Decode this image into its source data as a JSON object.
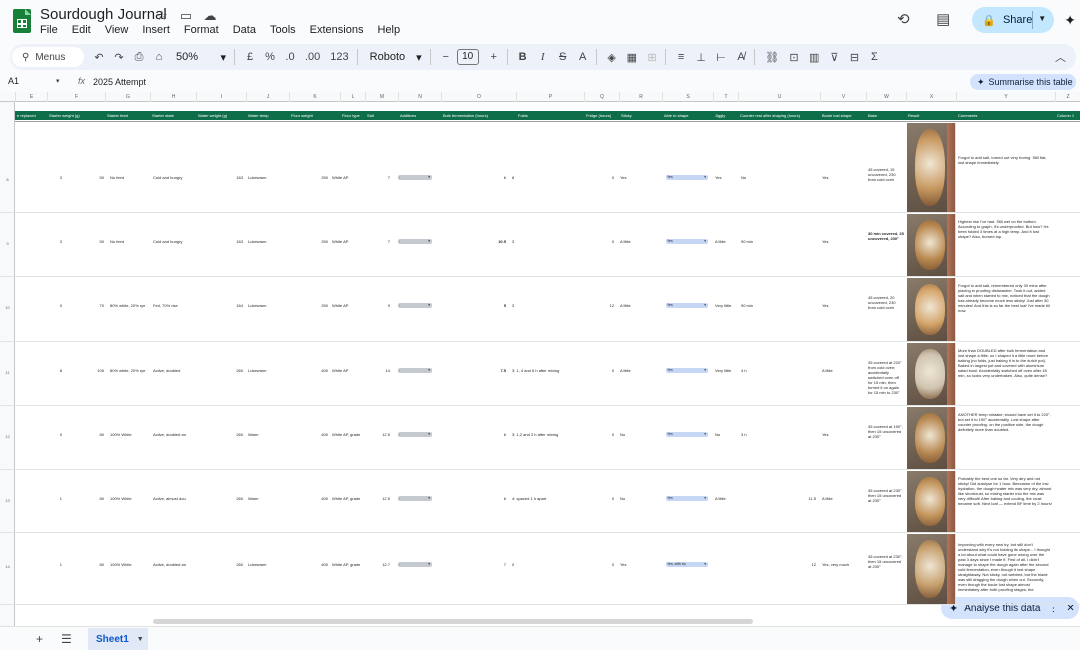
{
  "app": {
    "title": "Sourdough Journal",
    "menu": [
      "File",
      "Edit",
      "View",
      "Insert",
      "Format",
      "Data",
      "Tools",
      "Extensions",
      "Help"
    ],
    "share_label": "Share"
  },
  "toolbar": {
    "menus_label": "Menus",
    "zoom": "50%",
    "currency": "£",
    "percent": "%",
    "dec_dec": ".0",
    "dec_inc": ".00",
    "number_format": "123",
    "font": "Roboto",
    "font_size": "10"
  },
  "formula_bar": {
    "cell_ref": "A1",
    "fx": "fx",
    "content": "2025 Attempt",
    "summarise_label": "Summarise this table"
  },
  "grid": {
    "column_letters": [
      "E",
      "F",
      "G",
      "H",
      "I",
      "J",
      "K",
      "L",
      "M",
      "N",
      "O",
      "P",
      "Q",
      "R",
      "S",
      "T",
      "U",
      "V",
      "W",
      "X",
      "Y",
      "Z",
      "AA"
    ],
    "headers": [
      "e replaced",
      "Starter weight (g)",
      "Starter feed",
      "Starter state",
      "Water weight (g)",
      "Water temp",
      "Flour weight",
      "Flour type",
      "Salt",
      "Additives",
      "Bulk fermentation (hours)",
      "Folds",
      "Fridge (hours)",
      "Sticky",
      "Able to shape",
      "Jiggly",
      "Counter rest after shaping (hours)",
      "Boule lost shape",
      "Bake",
      "Result",
      "Comments",
      "Column 1"
    ],
    "rows": [
      {
        "n": "8",
        "e": "3",
        "f": "50",
        "g": "No feed",
        "h": "Cold and hungry",
        "i": "163",
        "j": "Lukewarm",
        "k": "250",
        "l": "White AP",
        "m": "7",
        "n2": "-",
        "o": "6",
        "o_bold": false,
        "p": "8",
        "q": "0",
        "r": "Yes",
        "s": "Yes",
        "t": "Yes",
        "u": "No",
        "v": "",
        "w": "Yes",
        "x": "45 covered, 15 uncovered, 230 from cold oven",
        "x_bold": false,
        "z": "Forgot to add salt, turned out very boring. Still flat, lost shape immediately."
      },
      {
        "n": "9",
        "e": "3",
        "f": "50",
        "g": "No feed",
        "h": "Cold and hungry",
        "i": "163",
        "j": "Lukewarm",
        "k": "250",
        "l": "White AP",
        "m": "7",
        "n2": "-",
        "o": "10.5",
        "o_bold": true,
        "p": "3",
        "q": "0",
        "r": "A little",
        "s": "Yes",
        "t": "A little",
        "u": "90 min",
        "v": "",
        "w": "Yes",
        "x": "30 min covered, 25 uncovered, 230°",
        "x_bold": true,
        "z": "Highest rise I've had. Still wet on the bottom. According to graph, it's underproofed. But how? It's been folded 3 times at a high temp. And it lost shape? Also, burned top."
      },
      {
        "n": "10",
        "e": "0",
        "f": "70",
        "g": "80% white, 20% rye",
        "h": "Fed, 70% rise",
        "i": "164",
        "j": "Lukewarm",
        "k": "250",
        "l": "White AP",
        "m": "9",
        "n2": "-",
        "o": "5",
        "o_bold": true,
        "p": "3",
        "q": "12",
        "r": "A little",
        "s": "Yes",
        "t": "Very little",
        "u": "90 min",
        "v": "",
        "w": "Yes",
        "x": "45 covered, 20 uncovered, 230 from cold oven",
        "x_bold": false,
        "z": "Forgot to add salt, remembered only 30 mins after placing in proofing dishwasher. Took it out, added salt and when started to mix, noticed that the dough has already become much less sticky! Just after 30 minutes! And this is so far the best loaf I've made till now."
      },
      {
        "n": "11",
        "e": "8",
        "f": "105",
        "g": "80% white, 20% rye",
        "h": "Active, doubled",
        "i": "260",
        "j": "Lukewarm",
        "k": "400",
        "l": "White AP",
        "m": "14",
        "n2": "-",
        "o": "7.5",
        "o_bold": true,
        "p": "3: 1, 4 and 6 h after mixing",
        "q": "0",
        "r": "A little",
        "s": "Yes",
        "t": "Very little",
        "u": "4 h",
        "v": "",
        "w": "A little",
        "x": "45 covered at 220° from cold oven; accidentally switched oven off for 15 min, then turned it on again for 15 min to 230°",
        "x_bold": false,
        "z": "More than DOUBLED after bulk fermentation and lost shape a little, so I shaped it a little more before baking (no folds, just baking it in to the dutch pot). Baked in largest pot and covered with aluminium salad bowl. Accidentally switched off oven after 45 min, so looks very underbaken. Also, quite dense?"
      },
      {
        "n": "12",
        "e": "0",
        "f": "80",
        "g": "100% White",
        "h": "Active, doubled an",
        "i": "260",
        "j": "Warm",
        "k": "400",
        "l": "White AP, grade",
        "m": "12.5",
        "n2": "-",
        "o": "6",
        "o_bold": false,
        "p": "3: 1,2 and 3 h after mixing",
        "q": "0",
        "r": "No",
        "s": "Yes",
        "t": "No",
        "u": "3 h",
        "v": "",
        "w": "Yes",
        "x": "45 covered at 190°, then 15 uncovered at 230°",
        "x_bold": false,
        "z": "ANOTHER temp mistake; should have set it to 220°, but set it to 190° accidentally. Lost shape after counter proofing. on the positive side, the dough definitely more than doubled."
      },
      {
        "n": "13",
        "e": "1",
        "f": "80",
        "g": "100% White",
        "h": "Active, almost dou",
        "i": "260",
        "j": "Warm",
        "k": "400",
        "l": "White AP, grade",
        "m": "12.5",
        "n2": "-",
        "o": "6",
        "o_bold": false,
        "p": "4: spaced 1 h apart",
        "q": "0",
        "r": "No",
        "s": "Yes",
        "t": "A little",
        "u": "",
        "v": "11.5",
        "w": "A little",
        "x": "45 covered at 230°, then 15 uncovered at 230°",
        "x_bold": false,
        "z": "Probably the best one so far. Very airy and not sticky! Did autolyse for 1 hour. Beecause of the low hydration, the dough+water mix was very dry, almost like shortcrust, so mixing starter into the mix was very difficult! After baking and cooling, the crust became soft. Next loaf — extend BF time by 2 hours!"
      },
      {
        "n": "14",
        "e": "1",
        "f": "80",
        "g": "100% White",
        "h": "Active, doubled an",
        "i": "260",
        "j": "Lukewarm",
        "k": "400",
        "l": "White AP, grade",
        "m": "12.7",
        "n2": "-",
        "o": "7",
        "o_bold": false,
        "p": "0",
        "q": "0",
        "r": "Yes",
        "s": "Yes, with bu",
        "t": "",
        "u": "",
        "v": "12",
        "w": "Yes, very much",
        "x": "45 covered at 230°, then 15 uncovered at 230°",
        "x_bold": false,
        "z": "Improving with every new try, but still don't understand why it's not holding its shape... I thought a lot about what could have gone wrong over the past 3 days since I made it. First of all, I didn't manage to shape the dough again after the second cold fermentation, even though it lost shape straightaway. Not sticky, not webbed, but the blade was still dragging the dough when cut. Secondly, even though the boule lost shape almost immediately after both proofing stages, the"
      }
    ]
  },
  "sheet": {
    "tab": "Sheet1"
  },
  "analyse_label": "Analyse this data",
  "colors": {
    "header_green": "#0f6e4a",
    "chip_blue": "#c6d7f5",
    "share_bg": "#c2e7ff",
    "accent": "#0b57d0"
  }
}
